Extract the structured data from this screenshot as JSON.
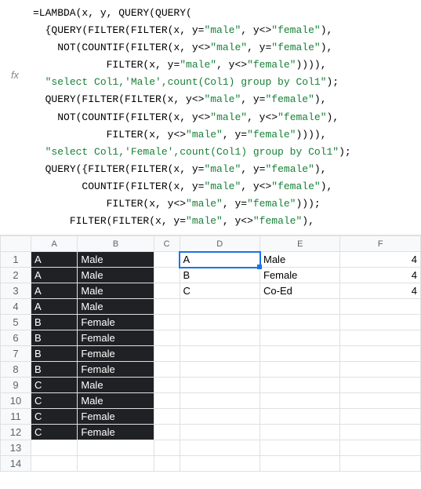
{
  "formula_bar": {
    "fx_label": "fx",
    "lines": [
      {
        "indent": 0,
        "tokens": [
          {
            "t": "=LAMBDA(x, y, QUERY(QUERY("
          }
        ]
      },
      {
        "indent": 1,
        "tokens": [
          {
            "t": "{QUERY(FILTER(FILTER(x, y="
          },
          {
            "t": "\"male\"",
            "s": 1
          },
          {
            "t": ", y<>"
          },
          {
            "t": "\"female\"",
            "s": 1
          },
          {
            "t": "),"
          }
        ]
      },
      {
        "indent": 2,
        "tokens": [
          {
            "t": "NOT(COUNTIF(FILTER(x, y<>"
          },
          {
            "t": "\"male\"",
            "s": 1
          },
          {
            "t": ", y="
          },
          {
            "t": "\"female\"",
            "s": 1
          },
          {
            "t": "),"
          }
        ]
      },
      {
        "indent": 6,
        "tokens": [
          {
            "t": "FILTER(x, y="
          },
          {
            "t": "\"male\"",
            "s": 1
          },
          {
            "t": ", y<>"
          },
          {
            "t": "\"female\"",
            "s": 1
          },
          {
            "t": ")))),"
          }
        ]
      },
      {
        "indent": 1,
        "tokens": [
          {
            "t": "\"select Col1,'Male',count(Col1) group by Col1\"",
            "s": 1
          },
          {
            "t": ");"
          }
        ]
      },
      {
        "indent": 1,
        "tokens": [
          {
            "t": "QUERY(FILTER(FILTER(x, y<>"
          },
          {
            "t": "\"male\"",
            "s": 1
          },
          {
            "t": ", y="
          },
          {
            "t": "\"female\"",
            "s": 1
          },
          {
            "t": "),"
          }
        ]
      },
      {
        "indent": 2,
        "tokens": [
          {
            "t": "NOT(COUNTIF(FILTER(x, y<>"
          },
          {
            "t": "\"male\"",
            "s": 1
          },
          {
            "t": ", y<>"
          },
          {
            "t": "\"female\"",
            "s": 1
          },
          {
            "t": "),"
          }
        ]
      },
      {
        "indent": 6,
        "tokens": [
          {
            "t": "FILTER(x, y<>"
          },
          {
            "t": "\"male\"",
            "s": 1
          },
          {
            "t": ", y="
          },
          {
            "t": "\"female\"",
            "s": 1
          },
          {
            "t": ")))),"
          }
        ]
      },
      {
        "indent": 1,
        "tokens": [
          {
            "t": "\"select Col1,'Female',count(Col1) group by Col1\"",
            "s": 1
          },
          {
            "t": ");"
          }
        ]
      },
      {
        "indent": 1,
        "tokens": [
          {
            "t": "QUERY({FILTER(FILTER(x, y="
          },
          {
            "t": "\"male\"",
            "s": 1
          },
          {
            "t": ", y="
          },
          {
            "t": "\"female\"",
            "s": 1
          },
          {
            "t": "),"
          }
        ]
      },
      {
        "indent": 4,
        "tokens": [
          {
            "t": "COUNTIF(FILTER(x, y="
          },
          {
            "t": "\"male\"",
            "s": 1
          },
          {
            "t": ", y<>"
          },
          {
            "t": "\"female\"",
            "s": 1
          },
          {
            "t": "),"
          }
        ]
      },
      {
        "indent": 6,
        "tokens": [
          {
            "t": "FILTER(x, y<>"
          },
          {
            "t": "\"male\"",
            "s": 1
          },
          {
            "t": ", y="
          },
          {
            "t": "\"female\"",
            "s": 1
          },
          {
            "t": ")));"
          }
        ]
      },
      {
        "indent": 3,
        "tokens": [
          {
            "t": "FILTER(FILTER(x, y="
          },
          {
            "t": "\"male\"",
            "s": 1
          },
          {
            "t": ", y<>"
          },
          {
            "t": "\"female\"",
            "s": 1
          },
          {
            "t": "),"
          }
        ]
      }
    ]
  },
  "columns": [
    "A",
    "B",
    "C",
    "D",
    "E",
    "F"
  ],
  "active_cell": "D1",
  "rows": [
    {
      "n": 1,
      "A": "A",
      "B": "Male",
      "D": "A",
      "E": "Male",
      "F": 4
    },
    {
      "n": 2,
      "A": "A",
      "B": "Male",
      "D": "B",
      "E": "Female",
      "F": 4
    },
    {
      "n": 3,
      "A": "A",
      "B": "Male",
      "D": "C",
      "E": "Co-Ed",
      "F": 4
    },
    {
      "n": 4,
      "A": "A",
      "B": "Male"
    },
    {
      "n": 5,
      "A": "B",
      "B": "Female"
    },
    {
      "n": 6,
      "A": "B",
      "B": "Female"
    },
    {
      "n": 7,
      "A": "B",
      "B": "Female"
    },
    {
      "n": 8,
      "A": "B",
      "B": "Female"
    },
    {
      "n": 9,
      "A": "C",
      "B": "Male"
    },
    {
      "n": 10,
      "A": "C",
      "B": "Male"
    },
    {
      "n": 11,
      "A": "C",
      "B": "Female"
    },
    {
      "n": 12,
      "A": "C",
      "B": "Female"
    },
    {
      "n": 13
    },
    {
      "n": 14
    }
  ],
  "chart_data": {
    "type": "table",
    "input_data": [
      {
        "letter": "A",
        "gender": "Male"
      },
      {
        "letter": "A",
        "gender": "Male"
      },
      {
        "letter": "A",
        "gender": "Male"
      },
      {
        "letter": "A",
        "gender": "Male"
      },
      {
        "letter": "B",
        "gender": "Female"
      },
      {
        "letter": "B",
        "gender": "Female"
      },
      {
        "letter": "B",
        "gender": "Female"
      },
      {
        "letter": "B",
        "gender": "Female"
      },
      {
        "letter": "C",
        "gender": "Male"
      },
      {
        "letter": "C",
        "gender": "Male"
      },
      {
        "letter": "C",
        "gender": "Female"
      },
      {
        "letter": "C",
        "gender": "Female"
      }
    ],
    "output_data": [
      {
        "letter": "A",
        "category": "Male",
        "count": 4
      },
      {
        "letter": "B",
        "category": "Female",
        "count": 4
      },
      {
        "letter": "C",
        "category": "Co-Ed",
        "count": 4
      }
    ]
  }
}
